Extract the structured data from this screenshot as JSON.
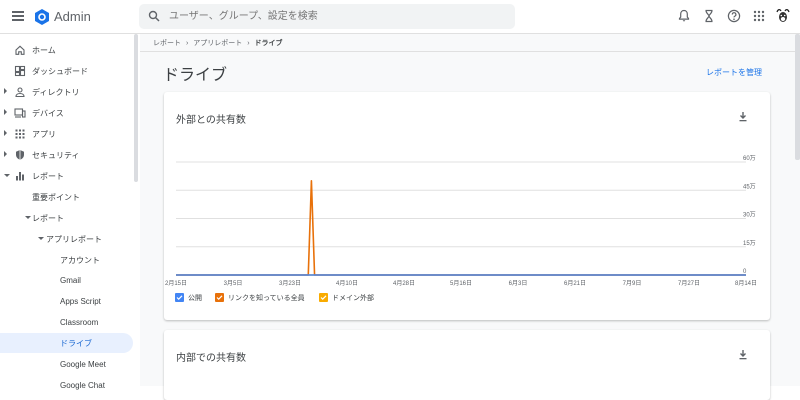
{
  "header": {
    "app_title": "Admin",
    "search_placeholder": "ユーザー、グループ、設定を検索",
    "icons": [
      "menu-icon",
      "admin-logo-icon",
      "search-icon",
      "notifications-icon",
      "hourglass-icon",
      "help-icon",
      "apps-grid-icon",
      "avatar"
    ]
  },
  "sidebar": {
    "items": [
      {
        "label": "ホーム",
        "icon": "home-icon",
        "expander": "none"
      },
      {
        "label": "ダッシュボード",
        "icon": "dashboard-icon",
        "expander": "none"
      },
      {
        "label": "ディレクトリ",
        "icon": "person-icon",
        "expander": "collapsed"
      },
      {
        "label": "デバイス",
        "icon": "devices-icon",
        "expander": "collapsed"
      },
      {
        "label": "アプリ",
        "icon": "apps-grid-icon",
        "expander": "collapsed"
      },
      {
        "label": "セキュリティ",
        "icon": "shield-icon",
        "expander": "collapsed"
      },
      {
        "label": "レポート",
        "icon": "bar-chart-icon",
        "expander": "expanded"
      },
      {
        "label": "重要ポイント",
        "expander": "none"
      },
      {
        "label": "レポート",
        "expander": "expanded"
      },
      {
        "label": "アプリレポート",
        "expander": "expanded"
      },
      {
        "label": "アカウント",
        "expander": "none"
      },
      {
        "label": "Gmail",
        "expander": "none"
      },
      {
        "label": "Apps Script",
        "expander": "none"
      },
      {
        "label": "Classroom",
        "expander": "none"
      },
      {
        "label": "ドライブ",
        "expander": "none",
        "active": true
      },
      {
        "label": "Google Meet",
        "expander": "none"
      },
      {
        "label": "Google Chat",
        "expander": "none"
      }
    ]
  },
  "breadcrumb": {
    "items": [
      "レポート",
      "アプリレポート"
    ],
    "current": "ドライブ",
    "separator": "›"
  },
  "page": {
    "title": "ドライブ",
    "manage_link": "レポートを管理"
  },
  "cards": [
    {
      "title": "外部との共有数",
      "download_icon": "download-icon"
    },
    {
      "title": "内部での共有数",
      "download_icon": "download-icon"
    }
  ],
  "chart_data": {
    "type": "line",
    "title": "外部との共有数",
    "x": [
      "2月15日",
      "3月5日",
      "3月23日",
      "4月10日",
      "4月28日",
      "5月16日",
      "6月3日",
      "6月21日",
      "7月9日",
      "7月27日",
      "8月14日"
    ],
    "y_ticks": [
      "0",
      "15万",
      "30万",
      "45万",
      "60万"
    ],
    "ylim": [
      0,
      600000
    ],
    "grid": true,
    "legend_position": "bottom-left",
    "series": [
      {
        "name": "公開",
        "color": "#4285f4",
        "values": [
          0,
          0,
          0,
          0,
          0,
          0,
          0,
          0,
          0,
          0,
          0
        ]
      },
      {
        "name": "リンクを知っている全員",
        "color": "#e8710a",
        "points": [
          [
            "2月15日",
            0
          ],
          [
            "3月28日",
            0
          ],
          [
            "3月29日",
            500000
          ],
          [
            "3月30日",
            0
          ],
          [
            "8月14日",
            0
          ]
        ]
      },
      {
        "name": "ドメイン外部",
        "color": "#f9ab00",
        "values": [
          0,
          0,
          0,
          0,
          0,
          0,
          0,
          0,
          0,
          0,
          0
        ]
      }
    ]
  },
  "colors": {
    "accent": "#1a73e8",
    "active_bg": "#e8f0fe",
    "series_blue": "#4285f4",
    "series_orange": "#e8710a",
    "series_yellow": "#f9ab00"
  }
}
